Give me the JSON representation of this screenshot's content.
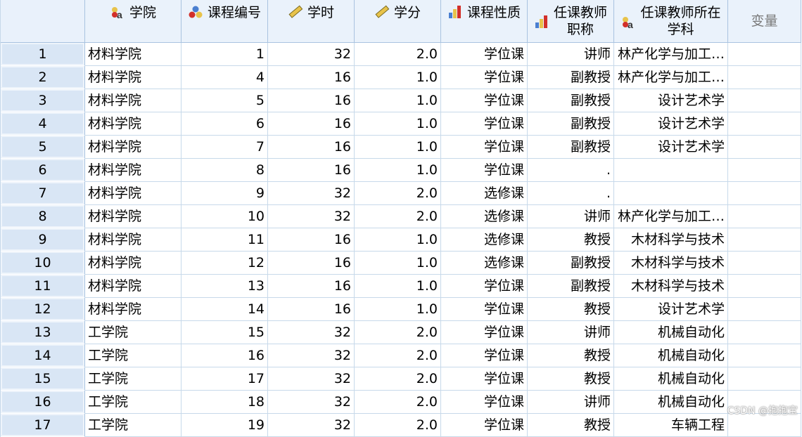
{
  "headers": [
    {
      "label": "学院",
      "icon": "nominal-icon"
    },
    {
      "label": "课程编号",
      "icon": "nominal-icon"
    },
    {
      "label": "学时",
      "icon": "scale-ruler-icon"
    },
    {
      "label": "学分",
      "icon": "scale-ruler-icon"
    },
    {
      "label": "课程性质",
      "icon": "ordinal-bar-icon"
    },
    {
      "label_line1": "任课教师",
      "label_line2": "职称",
      "icon": "ordinal-bar-icon"
    },
    {
      "label_line1": "任课教师所在",
      "label_line2": "学科",
      "icon": "nominal-string-icon"
    },
    {
      "label": "变量"
    }
  ],
  "rows": [
    {
      "n": "1",
      "c1": "材料学院",
      "c2": "1",
      "c3": "32",
      "c4": "2.0",
      "c5": "学位课",
      "c6": "讲师",
      "c7": "林产化学与加工…"
    },
    {
      "n": "2",
      "c1": "材料学院",
      "c2": "4",
      "c3": "16",
      "c4": "1.0",
      "c5": "学位课",
      "c6": "副教授",
      "c7": "林产化学与加工…"
    },
    {
      "n": "3",
      "c1": "材料学院",
      "c2": "5",
      "c3": "16",
      "c4": "1.0",
      "c5": "学位课",
      "c6": "副教授",
      "c7": "设计艺术学"
    },
    {
      "n": "4",
      "c1": "材料学院",
      "c2": "6",
      "c3": "16",
      "c4": "1.0",
      "c5": "学位课",
      "c6": "副教授",
      "c7": "设计艺术学"
    },
    {
      "n": "5",
      "c1": "材料学院",
      "c2": "7",
      "c3": "16",
      "c4": "1.0",
      "c5": "学位课",
      "c6": "副教授",
      "c7": "设计艺术学"
    },
    {
      "n": "6",
      "c1": "材料学院",
      "c2": "8",
      "c3": "16",
      "c4": "1.0",
      "c5": "学位课",
      "c6": ".",
      "c7": ""
    },
    {
      "n": "7",
      "c1": "材料学院",
      "c2": "9",
      "c3": "32",
      "c4": "2.0",
      "c5": "选修课",
      "c6": ".",
      "c7": ""
    },
    {
      "n": "8",
      "c1": "材料学院",
      "c2": "10",
      "c3": "32",
      "c4": "2.0",
      "c5": "选修课",
      "c6": "讲师",
      "c7": "林产化学与加工…"
    },
    {
      "n": "9",
      "c1": "材料学院",
      "c2": "11",
      "c3": "16",
      "c4": "1.0",
      "c5": "选修课",
      "c6": "教授",
      "c7": "木材科学与技术"
    },
    {
      "n": "10",
      "c1": "材料学院",
      "c2": "12",
      "c3": "16",
      "c4": "1.0",
      "c5": "选修课",
      "c6": "副教授",
      "c7": "木材科学与技术"
    },
    {
      "n": "11",
      "c1": "材料学院",
      "c2": "13",
      "c3": "16",
      "c4": "1.0",
      "c5": "学位课",
      "c6": "副教授",
      "c7": "木材科学与技术"
    },
    {
      "n": "12",
      "c1": "材料学院",
      "c2": "14",
      "c3": "16",
      "c4": "1.0",
      "c5": "学位课",
      "c6": "教授",
      "c7": "设计艺术学"
    },
    {
      "n": "13",
      "c1": "工学院",
      "c2": "15",
      "c3": "32",
      "c4": "2.0",
      "c5": "学位课",
      "c6": "讲师",
      "c7": "机械自动化"
    },
    {
      "n": "14",
      "c1": "工学院",
      "c2": "16",
      "c3": "32",
      "c4": "2.0",
      "c5": "学位课",
      "c6": "教授",
      "c7": "机械自动化"
    },
    {
      "n": "15",
      "c1": "工学院",
      "c2": "17",
      "c3": "32",
      "c4": "2.0",
      "c5": "学位课",
      "c6": "教授",
      "c7": "机械自动化"
    },
    {
      "n": "16",
      "c1": "工学院",
      "c2": "18",
      "c3": "32",
      "c4": "2.0",
      "c5": "学位课",
      "c6": "讲师",
      "c7": "机械自动化"
    },
    {
      "n": "17",
      "c1": "工学院",
      "c2": "19",
      "c3": "32",
      "c4": "2.0",
      "c5": "学位课",
      "c6": "教授",
      "c7": "车辆工程"
    }
  ],
  "watermark": "CSDN @抱抱宝"
}
